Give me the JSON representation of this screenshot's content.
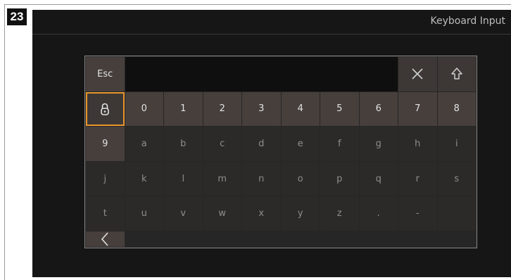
{
  "step_badge": "23",
  "header": {
    "title": "Keyboard Input"
  },
  "input": {
    "value": ""
  },
  "top_row": {
    "esc_label": "Esc",
    "clear_icon": "close-icon",
    "shift_icon": "shift-arrow-icon",
    "lock_icon": "padlock-icon"
  },
  "rows": [
    [
      "0",
      "1",
      "2",
      "3",
      "4",
      "5",
      "6",
      "7",
      "8",
      "9"
    ],
    [
      "a",
      "b",
      "c",
      "d",
      "e",
      "f",
      "g",
      "h",
      "i",
      "j"
    ],
    [
      "k",
      "l",
      "m",
      "n",
      "o",
      "p",
      "q",
      "r",
      "s",
      "t"
    ],
    [
      "u",
      "v",
      "w",
      "x",
      "y",
      "z",
      ".",
      "-",
      ""
    ]
  ],
  "backspace_icon": "chevron-left-icon",
  "colors": {
    "background": "#161616",
    "digit_key": "#463f3c",
    "letter_key": "#2c2a29",
    "focus_accent": "#e8952b"
  }
}
